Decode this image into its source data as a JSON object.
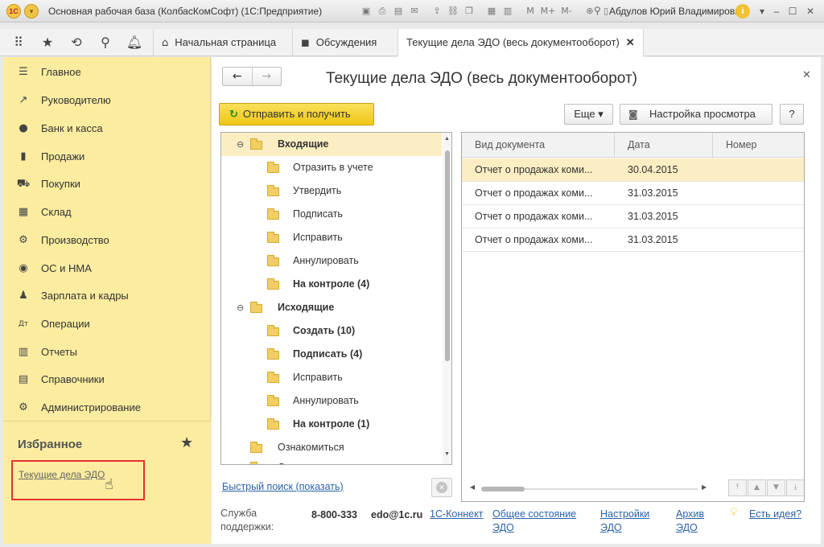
{
  "titlebar": {
    "logo": "1С",
    "title": "Основная рабочая база (КолбасКомСофт)  (1С:Предприятие)",
    "user": "Абдулов Юрий Владимирович",
    "m_buttons": [
      "M",
      "M+",
      "M-"
    ]
  },
  "tabs": [
    {
      "label": "Начальная страница",
      "icon": "home-icon"
    },
    {
      "label": "Обсуждения",
      "icon": "discussion-icon"
    },
    {
      "label": "Текущие дела ЭДО (весь документооборот)",
      "active": true
    }
  ],
  "sidebar": {
    "items": [
      {
        "label": "Главное",
        "icon": "menu-icon"
      },
      {
        "label": "Руководителю",
        "icon": "trend-icon"
      },
      {
        "label": "Банк и касса",
        "icon": "coin-icon"
      },
      {
        "label": "Продажи",
        "icon": "bag-icon"
      },
      {
        "label": "Покупки",
        "icon": "cart-icon"
      },
      {
        "label": "Склад",
        "icon": "warehouse-icon"
      },
      {
        "label": "Производство",
        "icon": "factory-icon"
      },
      {
        "label": "ОС и НМА",
        "icon": "assets-icon"
      },
      {
        "label": "Зарплата и кадры",
        "icon": "person-icon"
      },
      {
        "label": "Операции",
        "icon": "dtkt-icon"
      },
      {
        "label": "Отчеты",
        "icon": "report-icon"
      },
      {
        "label": "Справочники",
        "icon": "book-icon"
      },
      {
        "label": "Администрирование",
        "icon": "gear-icon"
      }
    ],
    "favorites_title": "Избранное",
    "favorites": [
      "Текущие дела ЭДО"
    ]
  },
  "main": {
    "title": "Текущие дела ЭДО (весь документооборот)",
    "send_button": "Отправить и получить",
    "more_button": "Еще",
    "view_settings_button": "Настройка просмотра",
    "help_button": "?",
    "quick_search": "Быстрый поиск (показать)"
  },
  "tree": [
    {
      "label": "Входящие",
      "level": 0,
      "bold": true,
      "expanded": true,
      "selected": true
    },
    {
      "label": "Отразить в учете",
      "level": 1
    },
    {
      "label": "Утвердить",
      "level": 1
    },
    {
      "label": "Подписать",
      "level": 1
    },
    {
      "label": "Исправить",
      "level": 1
    },
    {
      "label": "Аннулировать",
      "level": 1
    },
    {
      "label": "На контроле (4)",
      "level": 1,
      "bold": true
    },
    {
      "label": "Исходящие",
      "level": 0,
      "bold": true,
      "expanded": true
    },
    {
      "label": "Создать (10)",
      "level": 1,
      "bold": true
    },
    {
      "label": "Подписать (4)",
      "level": 1,
      "bold": true
    },
    {
      "label": "Исправить",
      "level": 1
    },
    {
      "label": "Аннулировать",
      "level": 1
    },
    {
      "label": "На контроле (1)",
      "level": 1,
      "bold": true
    },
    {
      "label": "Ознакомиться",
      "level": 0
    },
    {
      "label": "Отправить",
      "level": 0
    }
  ],
  "grid": {
    "columns": [
      "Вид документа",
      "Дата",
      "Номер"
    ],
    "rows": [
      [
        "Отчет о продажах коми...",
        "30.04.2015",
        ""
      ],
      [
        "Отчет о продажах коми...",
        "31.03.2015",
        ""
      ],
      [
        "Отчет о продажах коми...",
        "31.03.2015",
        ""
      ],
      [
        "Отчет о продажах коми...",
        "31.03.2015",
        ""
      ]
    ]
  },
  "footer": {
    "support_label_1": "Служба",
    "support_label_2": "поддержки:",
    "phone": "8-800-333",
    "email": "edo@1c.ru",
    "link_connect": "1С-Коннект",
    "link_status_1": "Общее состояние",
    "link_status_2": "ЭДО",
    "link_settings_1": "Настройки",
    "link_settings_2": "ЭДО",
    "link_archive_1": "Архив",
    "link_archive_2": "ЭДО",
    "link_idea": "Есть идея?"
  }
}
